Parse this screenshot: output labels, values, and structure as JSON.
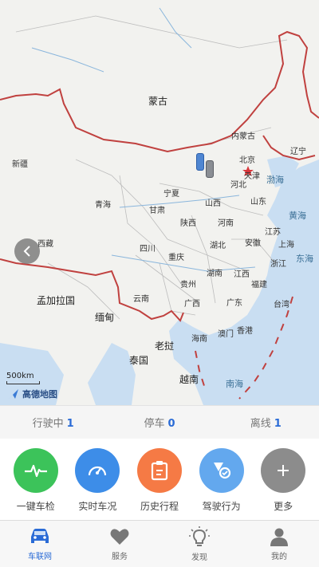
{
  "map": {
    "country_labels": [
      {
        "text": "蒙古",
        "pos": "mongolia"
      },
      {
        "text": "孟加拉国",
        "pos": "bangladesh"
      },
      {
        "text": "缅甸",
        "pos": "myanmar"
      },
      {
        "text": "老挝",
        "pos": "laos"
      },
      {
        "text": "泰国",
        "pos": "thailand"
      },
      {
        "text": "越南",
        "pos": "vietnam"
      }
    ],
    "province_labels": [
      "新疆",
      "西藏",
      "青海",
      "甘肃",
      "宁夏",
      "内蒙古",
      "辽宁",
      "北京",
      "天津",
      "河北",
      "山西",
      "山东",
      "陕西",
      "河南",
      "四川",
      "重庆",
      "湖北",
      "安徽",
      "江苏",
      "上海",
      "浙江",
      "贵州",
      "湖南",
      "江西",
      "福建",
      "云南",
      "广西",
      "广东",
      "台湾",
      "澳门",
      "香港",
      "海南"
    ],
    "sea_labels": [
      "渤海",
      "黄海",
      "东海",
      "南海"
    ],
    "scale_label": "500km",
    "logo_text": "高德地图"
  },
  "status": {
    "driving_label": "行驶中",
    "driving_count": "1",
    "parked_label": "停车",
    "parked_count": "0",
    "offline_label": "离线",
    "offline_count": "1"
  },
  "actions": [
    {
      "label": "一键车检",
      "color": "#3cc35a",
      "icon": "pulse-icon"
    },
    {
      "label": "实时车况",
      "color": "#3d8de8",
      "icon": "speedometer-icon"
    },
    {
      "label": "历史行程",
      "color": "#f57a45",
      "icon": "clipboard-icon"
    },
    {
      "label": "驾驶行为",
      "color": "#63a8ee",
      "icon": "badge-icon"
    },
    {
      "label": "更多",
      "color": "#8c8c8c",
      "icon": "plus-icon"
    }
  ],
  "tabs": [
    {
      "label": "车联网",
      "icon": "car-icon",
      "active": true
    },
    {
      "label": "服务",
      "icon": "heart-icon",
      "active": false
    },
    {
      "label": "发现",
      "icon": "lightbulb-icon",
      "active": false
    },
    {
      "label": "我的",
      "icon": "person-icon",
      "active": false
    }
  ],
  "colors": {
    "accent": "#2a6bd6",
    "border": "#c0413f",
    "sea": "#c9def2"
  }
}
